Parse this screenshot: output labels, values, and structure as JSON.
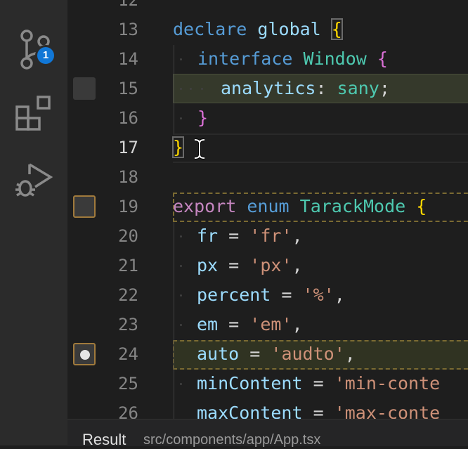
{
  "activity_bar": {
    "source_control_badge": "1"
  },
  "editor": {
    "lines": [
      {
        "number": "12"
      },
      {
        "number": "13",
        "tokens": [
          "declare",
          "global",
          "{"
        ]
      },
      {
        "number": "14",
        "tokens": [
          "interface",
          "Window",
          "{"
        ]
      },
      {
        "number": "15",
        "tokens": [
          "analytics",
          ":",
          "sany",
          ";"
        ]
      },
      {
        "number": "16",
        "tokens": [
          "}"
        ]
      },
      {
        "number": "17",
        "tokens": [
          "}"
        ]
      },
      {
        "number": "18"
      },
      {
        "number": "19",
        "tokens": [
          "export",
          "enum",
          "TarackMode",
          "{"
        ]
      },
      {
        "number": "20",
        "tokens": [
          "fr",
          "=",
          "'fr'",
          ","
        ]
      },
      {
        "number": "21",
        "tokens": [
          "px",
          "=",
          "'px'",
          ","
        ]
      },
      {
        "number": "22",
        "tokens": [
          "percent",
          "=",
          "'%'",
          ","
        ]
      },
      {
        "number": "23",
        "tokens": [
          "em",
          "=",
          "'em'",
          ","
        ]
      },
      {
        "number": "24",
        "tokens": [
          "auto",
          "=",
          "'audto'",
          ","
        ]
      },
      {
        "number": "25",
        "tokens": [
          "minContent",
          "=",
          "'min-conte"
        ]
      },
      {
        "number": "26",
        "tokens": [
          "maxContent",
          "=",
          "'max-conte"
        ]
      }
    ],
    "current_line": "17"
  },
  "result_bar": {
    "label": "Result",
    "path": "src/components/app/App.tsx"
  },
  "colors": {
    "keyword": "#569cd6",
    "type": "#4ec9b0",
    "variable": "#9cdcfe",
    "string": "#ce9178",
    "bracket_level1": "#ffd700",
    "bracket_level2": "#da70d6",
    "badge": "#1177d6"
  }
}
